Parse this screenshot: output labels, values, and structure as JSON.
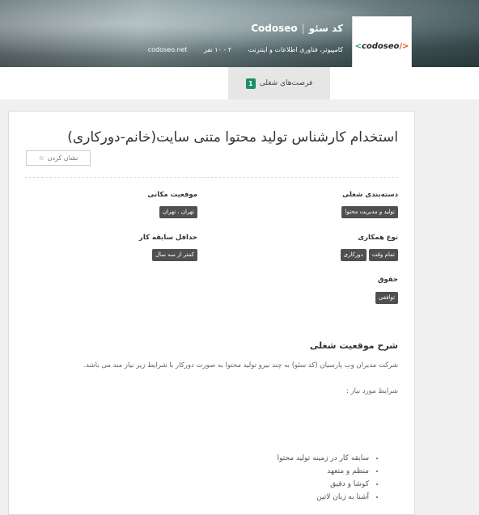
{
  "header": {
    "company_name_fa": "کد سئو",
    "company_name_en": "Codoseo",
    "industry": "کامپیوتر، فناوری اطلاعات و اینترنت",
    "size": "۲ - ۱۰ نفر",
    "website": "codoseo.net",
    "logo_text": "codoseo",
    "logo_left_glyph": "<",
    "logo_right_glyph": "/>"
  },
  "tabs": [
    {
      "label": "فرصت‌های شغلی",
      "badge": "1",
      "active": true
    }
  ],
  "job": {
    "title": "استخدام کارشناس تولید محتوا متنی سایت(خانم-دورکاری)",
    "bookmark_label": "نشان کردن",
    "fields": {
      "category": {
        "label": "دسته‌بندی شغلی",
        "tags": [
          "تولید و مدیریت محتوا"
        ]
      },
      "location": {
        "label": "موقعیت مکانی",
        "tags": [
          "تهران ، تهران"
        ]
      },
      "employment_type": {
        "label": "نوع همکاری",
        "tags": [
          "تمام وقت",
          "دورکاری"
        ]
      },
      "experience": {
        "label": "حداقل سابقه کار",
        "tags": [
          "کمتر از سه سال"
        ]
      },
      "salary": {
        "label": "حقوق",
        "tags": [
          "توافقی"
        ]
      }
    },
    "description_title": "شرح موقعیت شغلی",
    "description": "شرکت مدیران وب پارسیان (کد سئو) به چند نیرو تولید محتوا به صورت دورکار با شرایط زیر نیاز مند می باشد.",
    "requirements_title": "شرایط مورد نیاز :",
    "requirements": [
      "سابقه کار در زمینه تولید محتوا",
      "منظم و متعهد",
      "کوشا و دقیق",
      "آشنا به زبان لاتین"
    ]
  },
  "colors": {
    "accent": "#1d8f6a",
    "tag_bg": "#505050",
    "logo_green": "#27a376",
    "logo_orange": "#e8501f"
  }
}
